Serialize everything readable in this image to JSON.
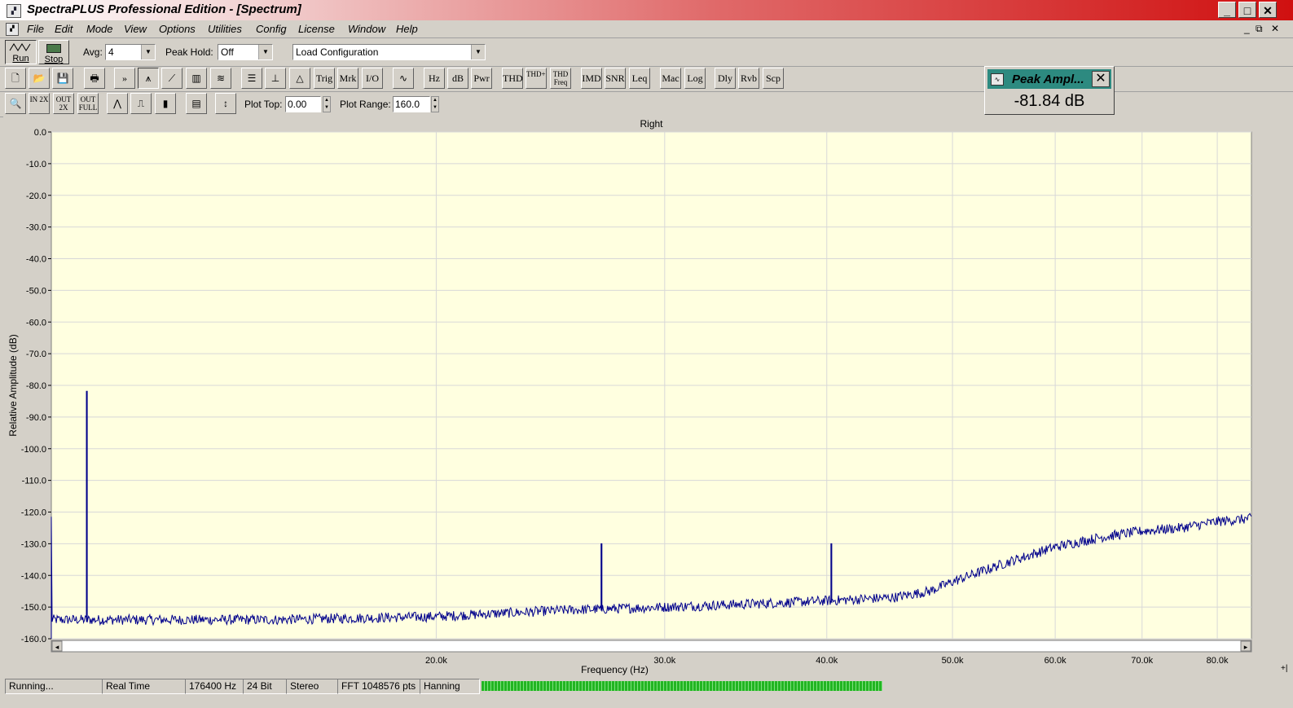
{
  "window": {
    "title": "SpectraPLUS Professional Edition - [Spectrum]",
    "app_icon": "spectra-app-icon",
    "controls": [
      "minimize",
      "maximize",
      "close"
    ]
  },
  "menubar": {
    "items": [
      "File",
      "Edit",
      "Mode",
      "View",
      "Options",
      "Utilities",
      "Config",
      "License",
      "Window",
      "Help"
    ]
  },
  "toolbar1": {
    "run_label": "Run",
    "stop_label": "Stop",
    "avg_label": "Avg:",
    "avg_value": "4",
    "peakhold_label": "Peak Hold:",
    "peakhold_value": "Off",
    "config_value": "Load Configuration"
  },
  "toolbar2": {
    "icon_buttons": [
      "new-icon",
      "open-icon",
      "save-icon",
      "print-icon",
      "fast-forward-icon",
      "spectrum-view-icon",
      "ramp-icon",
      "spectrogram-icon",
      "3d-surface-icon",
      "list-icon",
      "axis-icon",
      "peak-icon"
    ],
    "text_buttons": [
      "Trig",
      "Mrk",
      "I/O"
    ],
    "generator_icon": "sine-generator-icon",
    "text_buttons2": [
      "Hz",
      "dB",
      "Pwr",
      "THD",
      "THD+N",
      "THD Freq",
      "IMD",
      "SNR",
      "Leq",
      "Mac",
      "Log",
      "Dly",
      "Rvb",
      "Scp"
    ]
  },
  "toolbar3": {
    "icon_buttons": [
      "zoom-icon",
      "zoom-in-2x-icon",
      "zoom-out-2x-icon",
      "zoom-out-full-icon",
      "line-plot-icon",
      "step-plot-icon",
      "bar-plot-icon",
      "grid-toggle-icon",
      "autoscale-icon"
    ],
    "zoom_labels": [
      "IN 2X",
      "OUT 2X",
      "OUT FULL"
    ],
    "plot_top_label": "Plot Top:",
    "plot_top_value": "0.00",
    "plot_range_label": "Plot Range:",
    "plot_range_value": "160.0"
  },
  "peak_panel": {
    "title": "Peak Ampl...",
    "value": "-81.84 dB"
  },
  "chart_data": {
    "type": "line",
    "title": "Right",
    "xlabel": "Frequency (Hz)",
    "ylabel": "Relative Amplitude (dB)",
    "x_scale": "log",
    "xlim": [
      10100,
      85000
    ],
    "ylim": [
      -160,
      0
    ],
    "x_ticks": [
      20000,
      30000,
      40000,
      50000,
      60000,
      70000,
      80000
    ],
    "x_tick_labels": [
      "20.0k",
      "30.0k",
      "40.0k",
      "50.0k",
      "60.0k",
      "70.0k",
      "80.0k"
    ],
    "y_ticks": [
      0,
      -10,
      -20,
      -30,
      -40,
      -50,
      -60,
      -70,
      -80,
      -90,
      -100,
      -110,
      -120,
      -130,
      -140,
      -150,
      -160
    ],
    "y_tick_labels": [
      "0.0",
      "-10.0",
      "-20.0",
      "-30.0",
      "-40.0",
      "-50.0",
      "-60.0",
      "-70.0",
      "-80.0",
      "-90.0",
      "-100.0",
      "-110.0",
      "-120.0",
      "-130.0",
      "-140.0",
      "-150.0",
      "-160.0"
    ],
    "grid": true,
    "background": "#ffffe0",
    "line_color": "#00008b",
    "series": [
      {
        "noise_floor": {
          "x": [
            10100,
            12000,
            15000,
            20000,
            25000,
            30000,
            35000,
            40000,
            45000,
            48000,
            50000,
            55000,
            60000,
            65000,
            70000,
            75000,
            80000,
            85000
          ],
          "y": [
            -154,
            -154,
            -154,
            -153,
            -151,
            -150,
            -149,
            -148,
            -147,
            -145,
            -142,
            -136,
            -131,
            -128,
            -126,
            -125,
            -123,
            -122
          ]
        },
        "peaks": [
          {
            "x": 10750,
            "y": -81.84
          },
          {
            "x": 26800,
            "y": -130
          },
          {
            "x": 40300,
            "y": -130
          }
        ]
      }
    ]
  },
  "statusbar": {
    "state": "Running...",
    "mode": "Real Time",
    "sample_rate": "176400 Hz",
    "bits": "24 Bit",
    "channels": "Stereo",
    "fft_size": "FFT 1048576 pts",
    "window": "Hanning"
  },
  "colors": {
    "plot_bg": "#ffffe0",
    "trace": "#00008b",
    "peak_panel_header": "#2d8a80",
    "meter": "#22b522"
  }
}
